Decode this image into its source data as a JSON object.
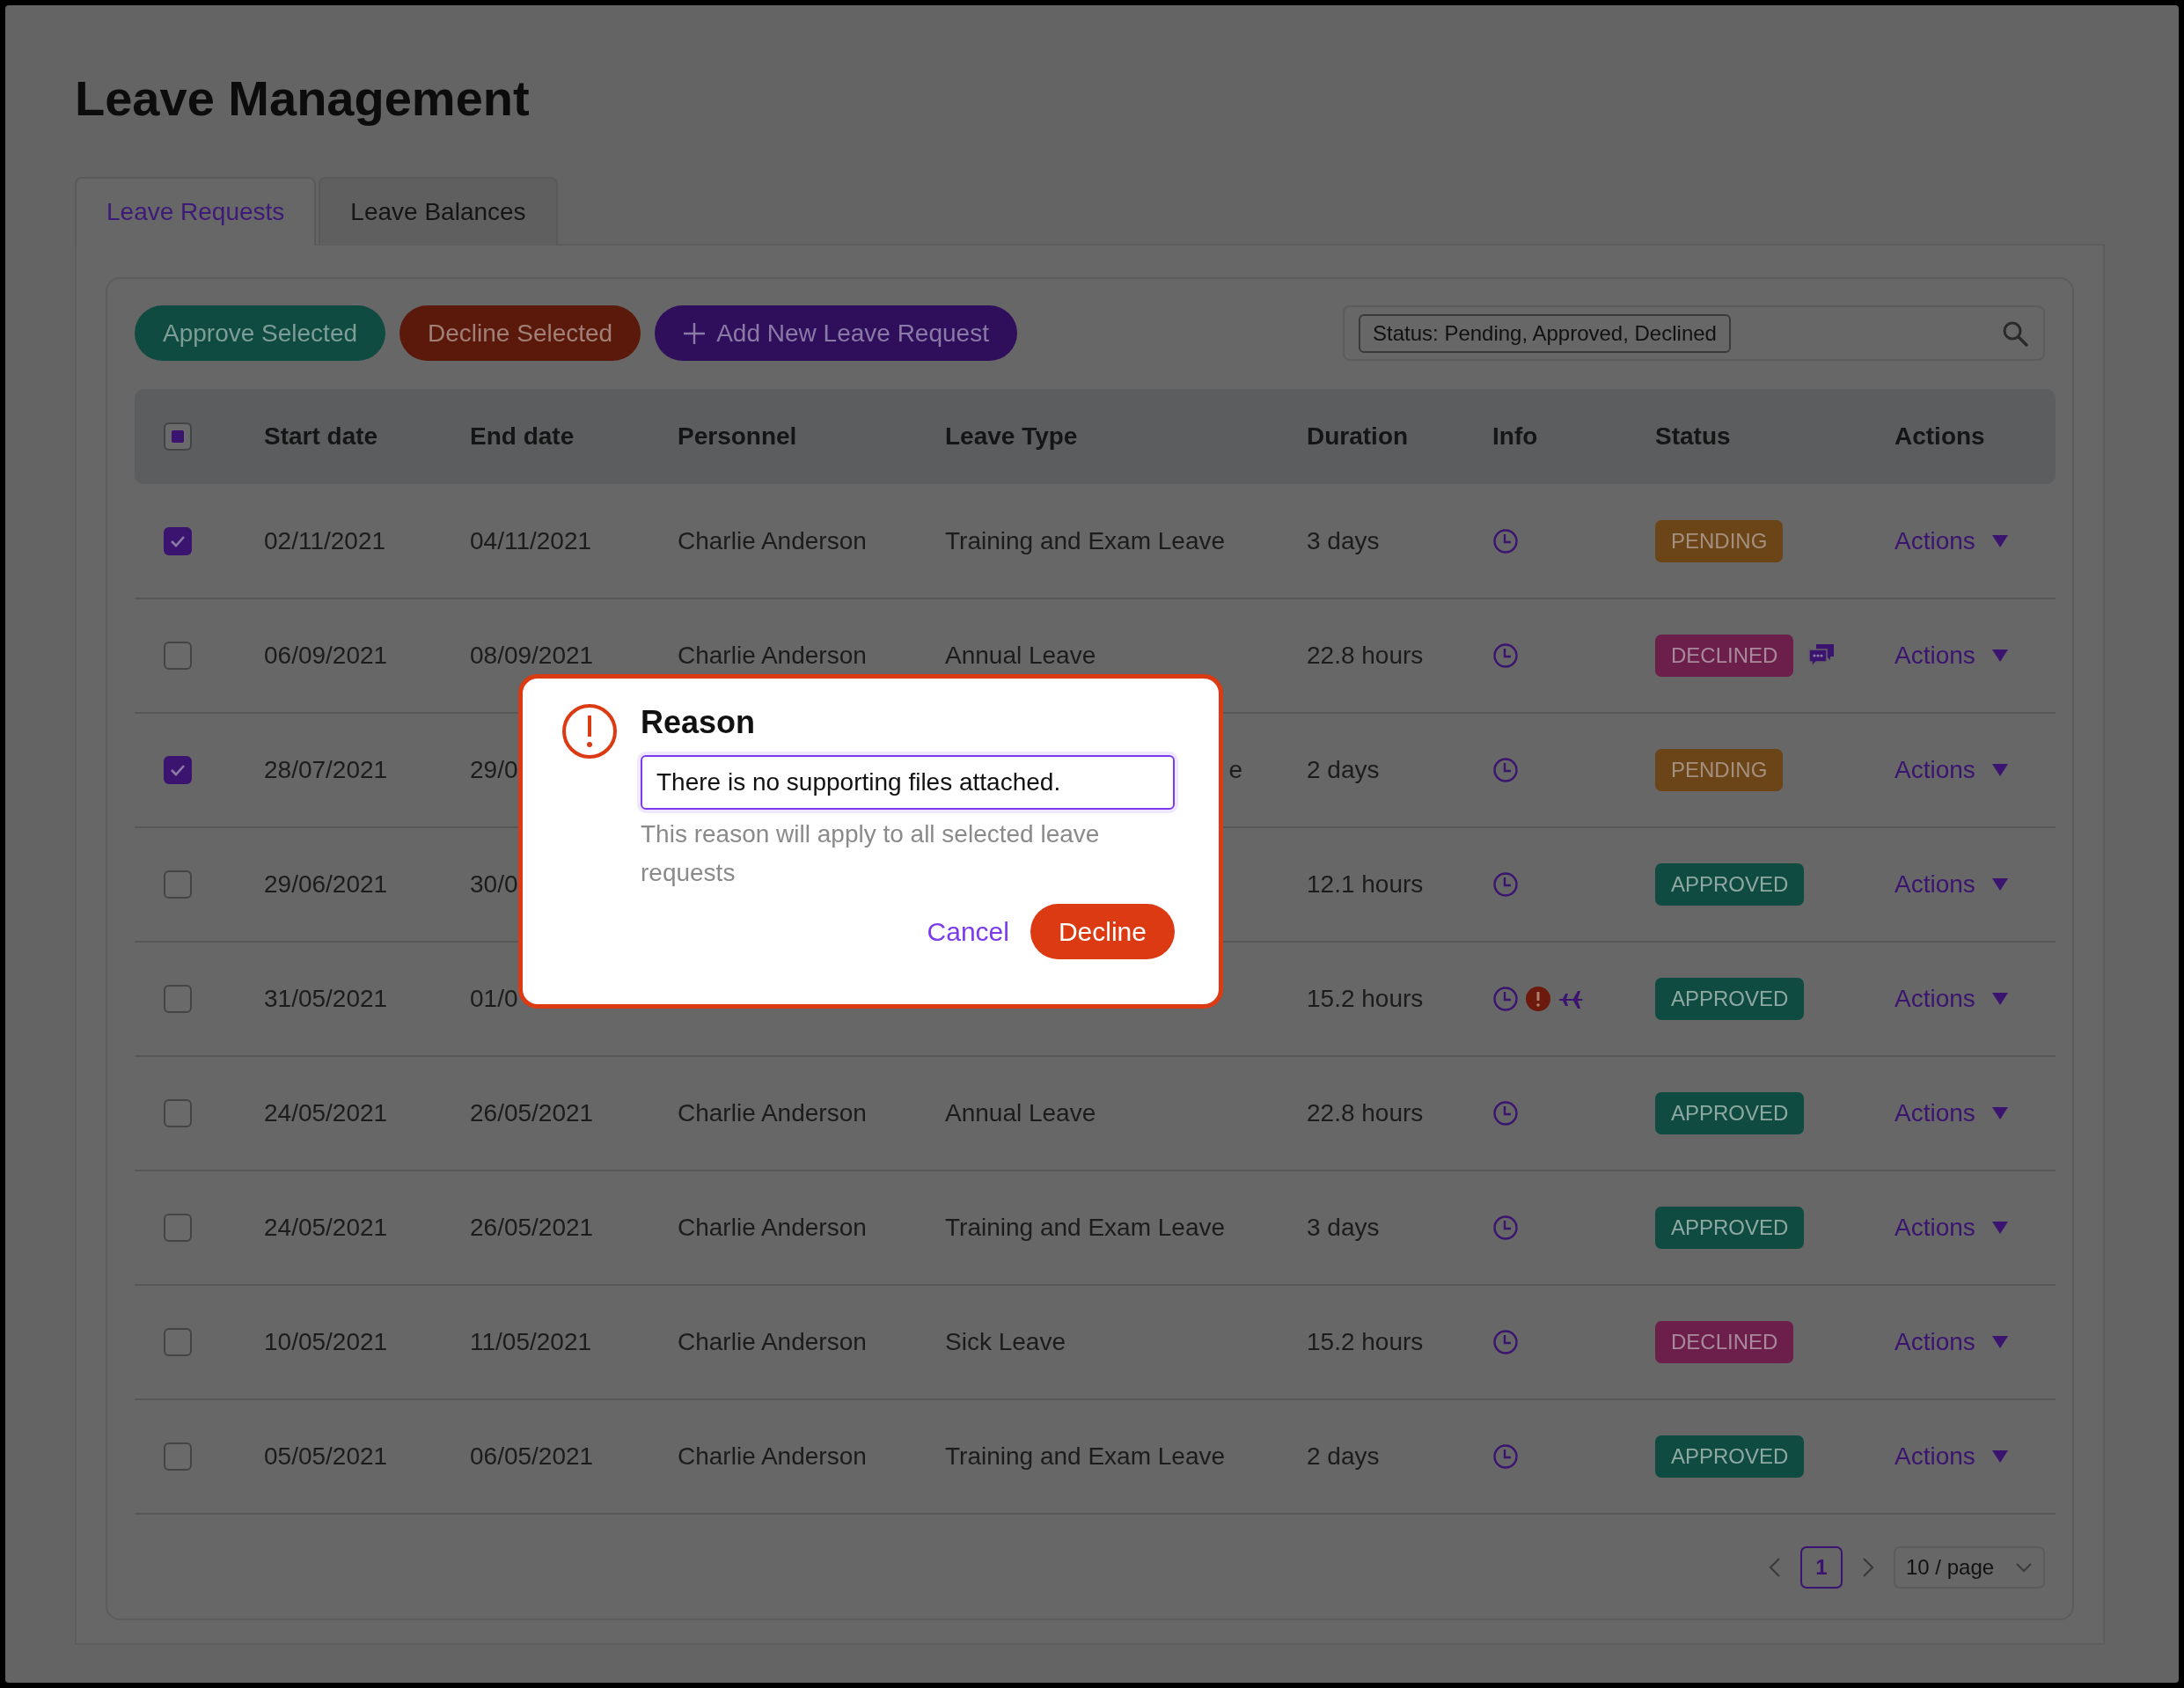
{
  "page": {
    "title": "Leave Management"
  },
  "tabs": [
    {
      "label": "Leave Requests",
      "selected": true
    },
    {
      "label": "Leave Balances",
      "selected": false
    }
  ],
  "toolbar": {
    "buttons": [
      {
        "label": "Approve Selected",
        "kind": "approve"
      },
      {
        "label": "Decline Selected",
        "kind": "decline"
      },
      {
        "label": "Add New Leave Request",
        "kind": "add"
      }
    ],
    "search": {
      "tags": [
        "Status: Pending, Approved, Declined"
      ]
    }
  },
  "table": {
    "select_all": {
      "indeterminate": true
    },
    "columns": [
      "Start date",
      "End date",
      "Personnel",
      "Leave Type",
      "Duration",
      "Info",
      "Status",
      "Actions"
    ],
    "rows": [
      {
        "checked": true,
        "start_date": "02/11/2021",
        "end_date": "04/11/2021",
        "personnel": "Charlie Anderson",
        "leave_type": "Training and Exam Leave",
        "duration": "3 days",
        "info": [
          {
            "kind": "clock"
          }
        ],
        "status": {
          "label": "PENDING",
          "kind": "pending"
        },
        "comment": false,
        "action": "Actions"
      },
      {
        "checked": false,
        "start_date": "06/09/2021",
        "end_date": "08/09/2021",
        "personnel": "Charlie Anderson",
        "leave_type": "Annual Leave",
        "duration": "22.8 hours",
        "info": [
          {
            "kind": "clock"
          }
        ],
        "status": {
          "label": "DECLINED",
          "kind": "declined"
        },
        "comment": true,
        "action": "Actions"
      },
      {
        "checked": true,
        "start_date": "28/07/2021",
        "end_date": "29/0",
        "leave_type": "e",
        "leave_type_cut": true,
        "duration": "2 days",
        "info": [
          {
            "kind": "clock"
          }
        ],
        "status": {
          "label": "PENDING",
          "kind": "pending"
        },
        "comment": false,
        "action": "Actions"
      },
      {
        "checked": false,
        "start_date": "29/06/2021",
        "end_date": "30/0",
        "duration": "12.1 hours",
        "info": [
          {
            "kind": "clock"
          }
        ],
        "status": {
          "label": "APPROVED",
          "kind": "approved"
        },
        "comment": false,
        "action": "Actions"
      },
      {
        "checked": false,
        "start_date": "31/05/2021",
        "end_date": "01/0",
        "duration": "15.2 hours",
        "info": [
          {
            "kind": "clock"
          },
          {
            "kind": "alert"
          },
          {
            "kind": "plane"
          }
        ],
        "status": {
          "label": "APPROVED",
          "kind": "approved"
        },
        "comment": false,
        "action": "Actions"
      },
      {
        "checked": false,
        "start_date": "24/05/2021",
        "end_date": "26/05/2021",
        "personnel": "Charlie Anderson",
        "leave_type": "Annual Leave",
        "duration": "22.8 hours",
        "info": [
          {
            "kind": "clock"
          }
        ],
        "status": {
          "label": "APPROVED",
          "kind": "approved"
        },
        "comment": false,
        "action": "Actions"
      },
      {
        "checked": false,
        "start_date": "24/05/2021",
        "end_date": "26/05/2021",
        "personnel": "Charlie Anderson",
        "leave_type": "Training and Exam Leave",
        "duration": "3 days",
        "info": [
          {
            "kind": "clock"
          }
        ],
        "status": {
          "label": "APPROVED",
          "kind": "approved"
        },
        "comment": false,
        "action": "Actions"
      },
      {
        "checked": false,
        "start_date": "10/05/2021",
        "end_date": "11/05/2021",
        "personnel": "Charlie Anderson",
        "leave_type": "Sick Leave",
        "duration": "15.2 hours",
        "info": [
          {
            "kind": "clock"
          }
        ],
        "status": {
          "label": "DECLINED",
          "kind": "declined"
        },
        "comment": false,
        "action": "Actions"
      },
      {
        "checked": false,
        "start_date": "05/05/2021",
        "end_date": "06/05/2021",
        "personnel": "Charlie Anderson",
        "leave_type": "Training and Exam Leave",
        "duration": "2 days",
        "info": [
          {
            "kind": "clock"
          }
        ],
        "status": {
          "label": "APPROVED",
          "kind": "approved"
        },
        "comment": false,
        "action": "Actions"
      }
    ]
  },
  "pagination": {
    "pages": [
      {
        "label": "1",
        "selected": true
      }
    ],
    "page_size": "10 / page"
  },
  "dialog": {
    "title": "Reason",
    "value": "There is no supporting files attached.",
    "help": "This reason will apply to all selected leave requests",
    "buttons": [
      {
        "label": "Cancel",
        "kind": "link"
      },
      {
        "label": "Decline",
        "kind": "danger"
      }
    ]
  }
}
